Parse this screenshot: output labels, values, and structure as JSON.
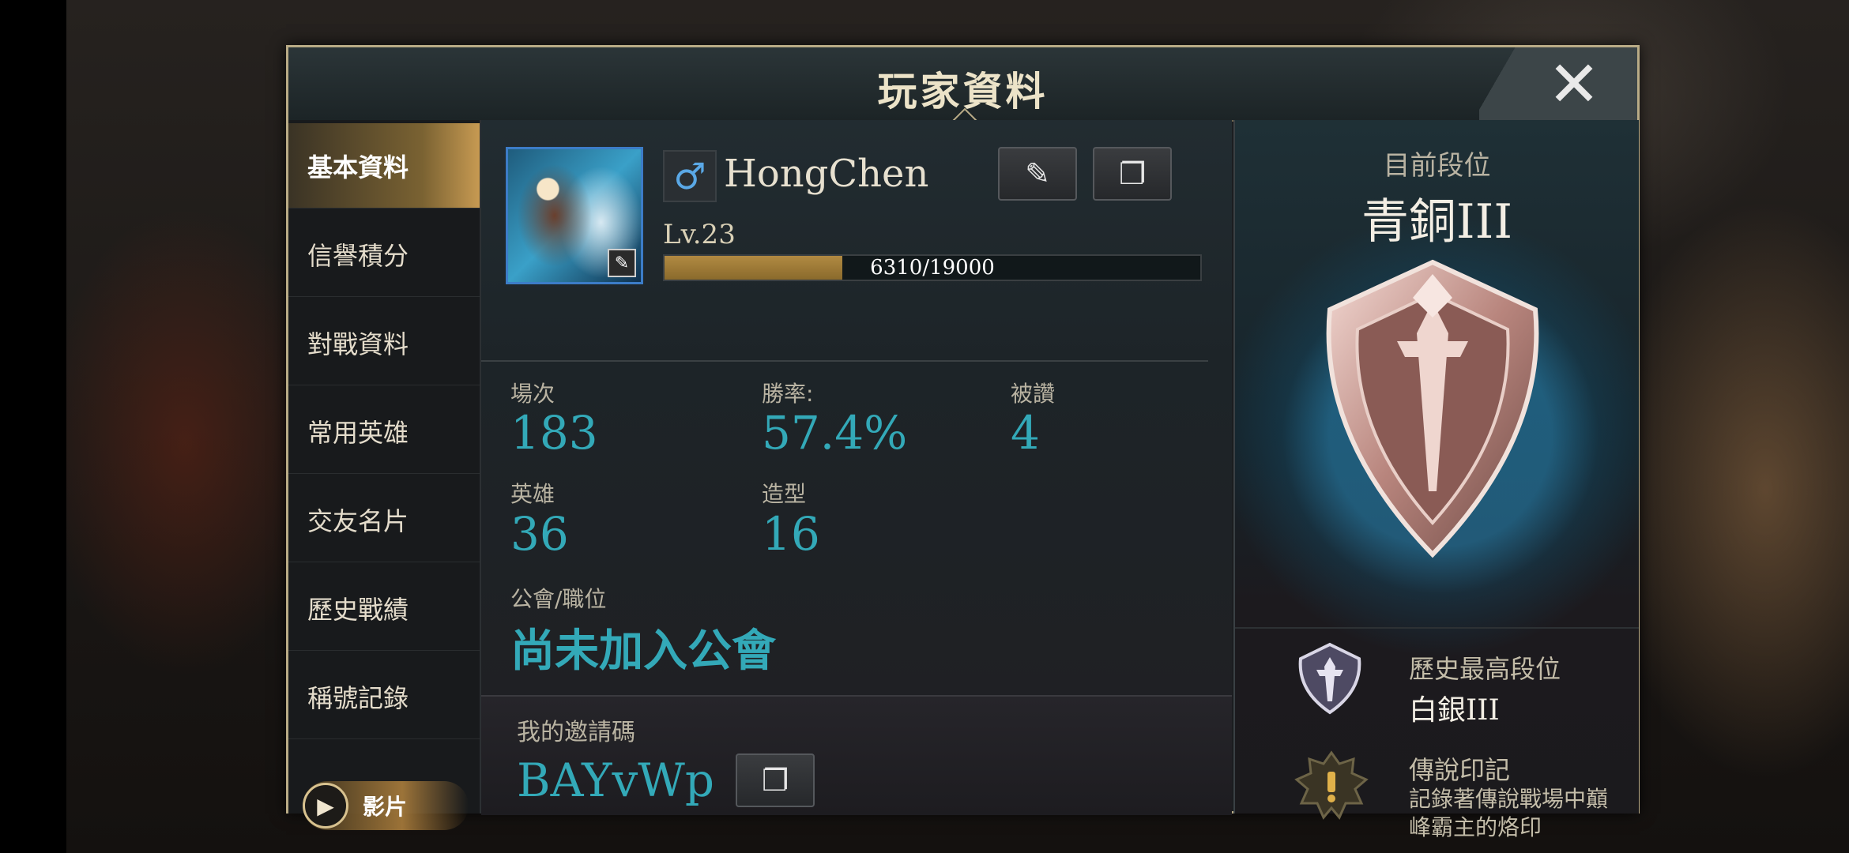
{
  "dialog": {
    "title": "玩家資料",
    "close_glyph": "✕"
  },
  "sidebar": {
    "items": [
      {
        "label": "基本資料",
        "active": true
      },
      {
        "label": "信譽積分",
        "active": false
      },
      {
        "label": "對戰資料",
        "active": false
      },
      {
        "label": "常用英雄",
        "active": false
      },
      {
        "label": "交友名片",
        "active": false
      },
      {
        "label": "歷史戰績",
        "active": false
      },
      {
        "label": "稱號記錄",
        "active": false
      }
    ],
    "video_label": "影片"
  },
  "profile": {
    "name": "HongChen",
    "gender_icon": "male-icon",
    "gender_glyph": "♂",
    "level": "Lv.23",
    "exp_text": "6310/19000",
    "exp_fraction": 0.332
  },
  "stats": {
    "matches_label": "場次",
    "matches_value": "183",
    "winrate_label": "勝率:",
    "winrate_value": "57.4%",
    "likes_label": "被讚",
    "likes_value": "4",
    "heroes_label": "英雄",
    "heroes_value": "36",
    "skins_label": "造型",
    "skins_value": "16",
    "guild_label": "公會/職位",
    "guild_value": "尚未加入公會"
  },
  "invite": {
    "label": "我的邀請碼",
    "code": "BAYvWp"
  },
  "rank": {
    "current_label": "目前段位",
    "current_value": "青銅III",
    "highest_label": "歷史最高段位",
    "highest_value": "白銀III",
    "legend_title": "傳說印記",
    "legend_desc": "記錄著傳說戰場中巔峰霸主的烙印"
  },
  "colors": {
    "accent_teal": "#33a9b8",
    "gold": "#c79a52",
    "border_gold": "#b9ab86"
  }
}
